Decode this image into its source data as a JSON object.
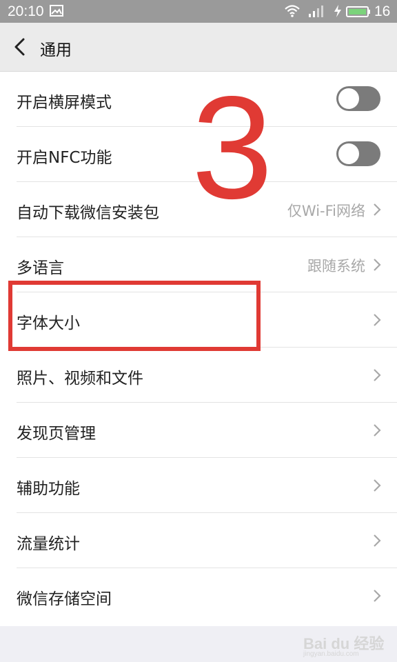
{
  "status_bar": {
    "time": "20:10",
    "battery_level": "16",
    "icons": [
      "image-icon",
      "wifi-icon",
      "signal-icon",
      "charging-icon",
      "battery-icon"
    ]
  },
  "header": {
    "title": "通用",
    "back_icon": "chevron-left-icon"
  },
  "settings": [
    {
      "label": "开启横屏模式",
      "type": "toggle",
      "on": false
    },
    {
      "label": "开启NFC功能",
      "type": "toggle",
      "on": false
    },
    {
      "label": "自动下载微信安装包",
      "type": "link",
      "value": "仅Wi-Fi网络"
    },
    {
      "label": "多语言",
      "type": "link",
      "value": "跟随系统"
    },
    {
      "label": "字体大小",
      "type": "link",
      "value": ""
    },
    {
      "label": "照片、视频和文件",
      "type": "link",
      "value": ""
    },
    {
      "label": "发现页管理",
      "type": "link",
      "value": ""
    },
    {
      "label": "辅助功能",
      "type": "link",
      "value": ""
    },
    {
      "label": "流量统计",
      "type": "link",
      "value": ""
    },
    {
      "label": "微信存储空间",
      "type": "link",
      "value": ""
    }
  ],
  "annotation": {
    "step_number": "3",
    "highlighted_item": "字体大小",
    "color": "#e03a34"
  },
  "watermark": {
    "text": "Bai du 经验",
    "subtext": "jingyan.baidu.com"
  },
  "colors": {
    "toggle_off": "#7b7b7b",
    "header_bg": "#ebebeb",
    "status_bar_bg": "#9a9a9a",
    "value_text": "#a8a8a8"
  }
}
